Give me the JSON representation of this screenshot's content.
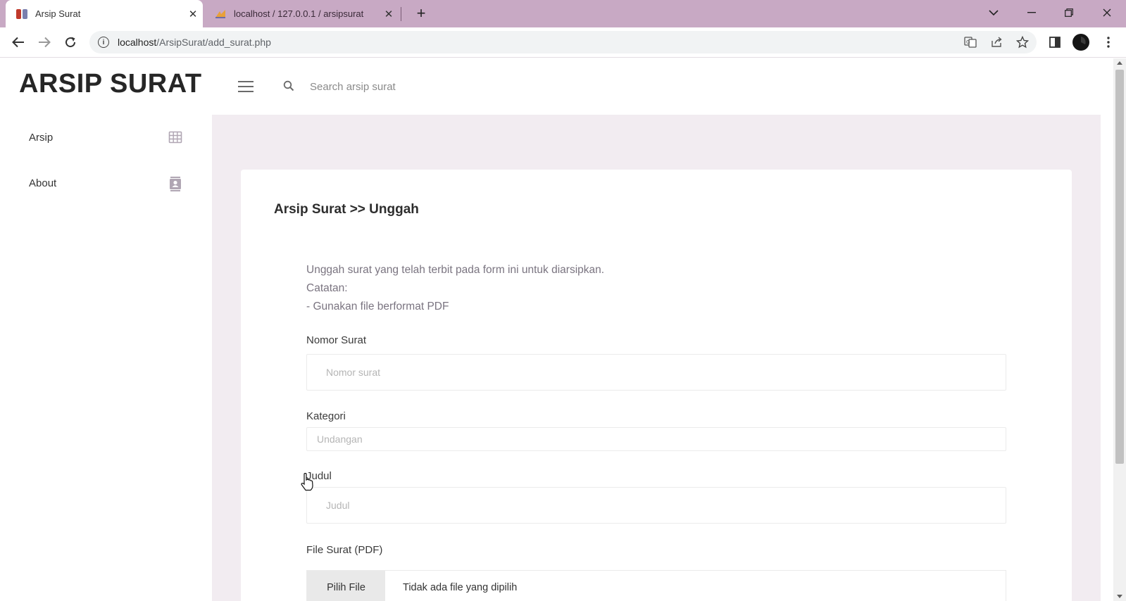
{
  "browser": {
    "tabs": [
      {
        "title": "Arsip Surat",
        "active": true
      },
      {
        "title": "localhost / 127.0.0.1 / arsipsurat",
        "active": false
      }
    ],
    "address": {
      "host": "localhost",
      "path": "/ArsipSurat/add_surat.php"
    }
  },
  "header": {
    "brand": "ARSIP SURAT",
    "search_placeholder": "Search arsip surat"
  },
  "sidebar": {
    "items": [
      {
        "label": "Arsip",
        "icon": "table-grid-icon"
      },
      {
        "label": "About",
        "icon": "contact-card-icon"
      }
    ]
  },
  "main": {
    "title": "Arsip Surat >> Unggah",
    "description": [
      "Unggah surat yang telah terbit pada form ini untuk diarsipkan.",
      "Catatan:",
      "- Gunakan file berformat PDF"
    ],
    "form": {
      "nomor": {
        "label": "Nomor Surat",
        "placeholder": "Nomor surat"
      },
      "kategori": {
        "label": "Kategori",
        "selected": "Undangan"
      },
      "judul": {
        "label": "Judul",
        "placeholder": "Judul"
      },
      "file": {
        "label": "File Surat (PDF)",
        "button": "Pilih File",
        "status": "Tidak ada file yang dipilih"
      }
    }
  },
  "colors": {
    "tabbar": "#c8a9c4",
    "content_bg": "#f2ecf1",
    "brand_text": "#262626"
  }
}
